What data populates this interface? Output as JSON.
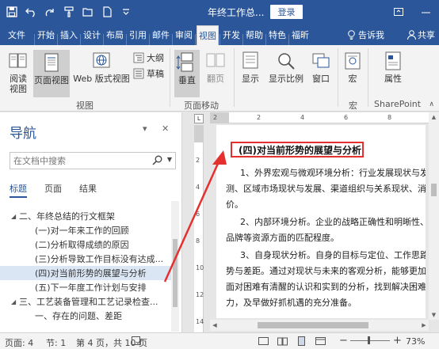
{
  "window": {
    "title": "年终工作总...",
    "login": "登录",
    "qat": [
      "save-icon",
      "undo-icon",
      "redo-icon",
      "format-painter-icon",
      "open-icon",
      "new-doc-icon",
      "customize-icon"
    ]
  },
  "tabs": {
    "file": "文件",
    "items": [
      "开始",
      "插入",
      "设计",
      "布局",
      "引用",
      "邮件",
      "审阅",
      "视图",
      "开发",
      "帮助",
      "特色",
      "福昕"
    ],
    "active": "视图",
    "tell": "告诉我",
    "share": "共享"
  },
  "ribbon": {
    "read_mode": "阅读\n视图",
    "print_layout": "页面视图",
    "web_layout": "Web 版式视图",
    "outline": "大纲",
    "draft": "草稿",
    "group_views": "视图",
    "vertical": "垂直",
    "side_by_side": "翻页",
    "group_page_move": "页面移动",
    "show": "显示",
    "zoom": "显示比例",
    "window": "窗口",
    "macros": "宏",
    "group_macros": "宏",
    "properties": "属性",
    "group_sharepoint": "SharePoint"
  },
  "nav": {
    "title": "导航",
    "search_placeholder": "在文档中搜索",
    "tabs": [
      "标题",
      "页面",
      "结果"
    ],
    "items": [
      {
        "text": "二、年终总结的行文框架",
        "level": 1
      },
      {
        "text": "(一)对一年来工作的回顾",
        "level": 2
      },
      {
        "text": "(二)分析取得成绩的原因",
        "level": 2
      },
      {
        "text": "(三)分析导致工作目标没有达成...",
        "level": 2
      },
      {
        "text": "(四)对当前形势的展望与分析",
        "level": 2,
        "selected": true
      },
      {
        "text": "(五)下一年度工作计划与安排",
        "level": 2
      },
      {
        "text": "三、工艺装备管理和工艺记录检查...",
        "level": 1
      },
      {
        "text": "一、存在的问题、差距",
        "level": 2
      }
    ]
  },
  "document": {
    "heading": "(四)对当前形势的展望与分析",
    "lines": [
      "1、外界宏观与微观环境分析：行业发展现状与发展、",
      "测、区域市场现状与发展、渠道组织与关系现状、消费",
      "价。",
      "2、内部环境分析。企业的战略正确性和明晰性、企",
      "品牌等资源方面的匹配程度。",
      "3、自身现状分析。自身的目标与定位、工作思路和",
      "势与差距。通过对现状与未来的客观分析，能够更加清",
      "面对困难有清醒的认识和实到的分析，找到解决困难的",
      "力，及早做好抓机遇的充分准备。"
    ],
    "ruler_ticks": [
      "2",
      "2",
      "4",
      "6",
      "8"
    ],
    "left_ruler_ticks": [
      "2",
      "4",
      "6",
      "8",
      "10",
      "12",
      "14"
    ]
  },
  "status": {
    "page": "页面: 4",
    "section": "节: 1",
    "page_of": "第 4 页，共 10 页",
    "zoom": "73%"
  },
  "colors": {
    "brand": "#2b579a",
    "annotation": "#e53030",
    "nav_selected": "#dbe6f5"
  }
}
